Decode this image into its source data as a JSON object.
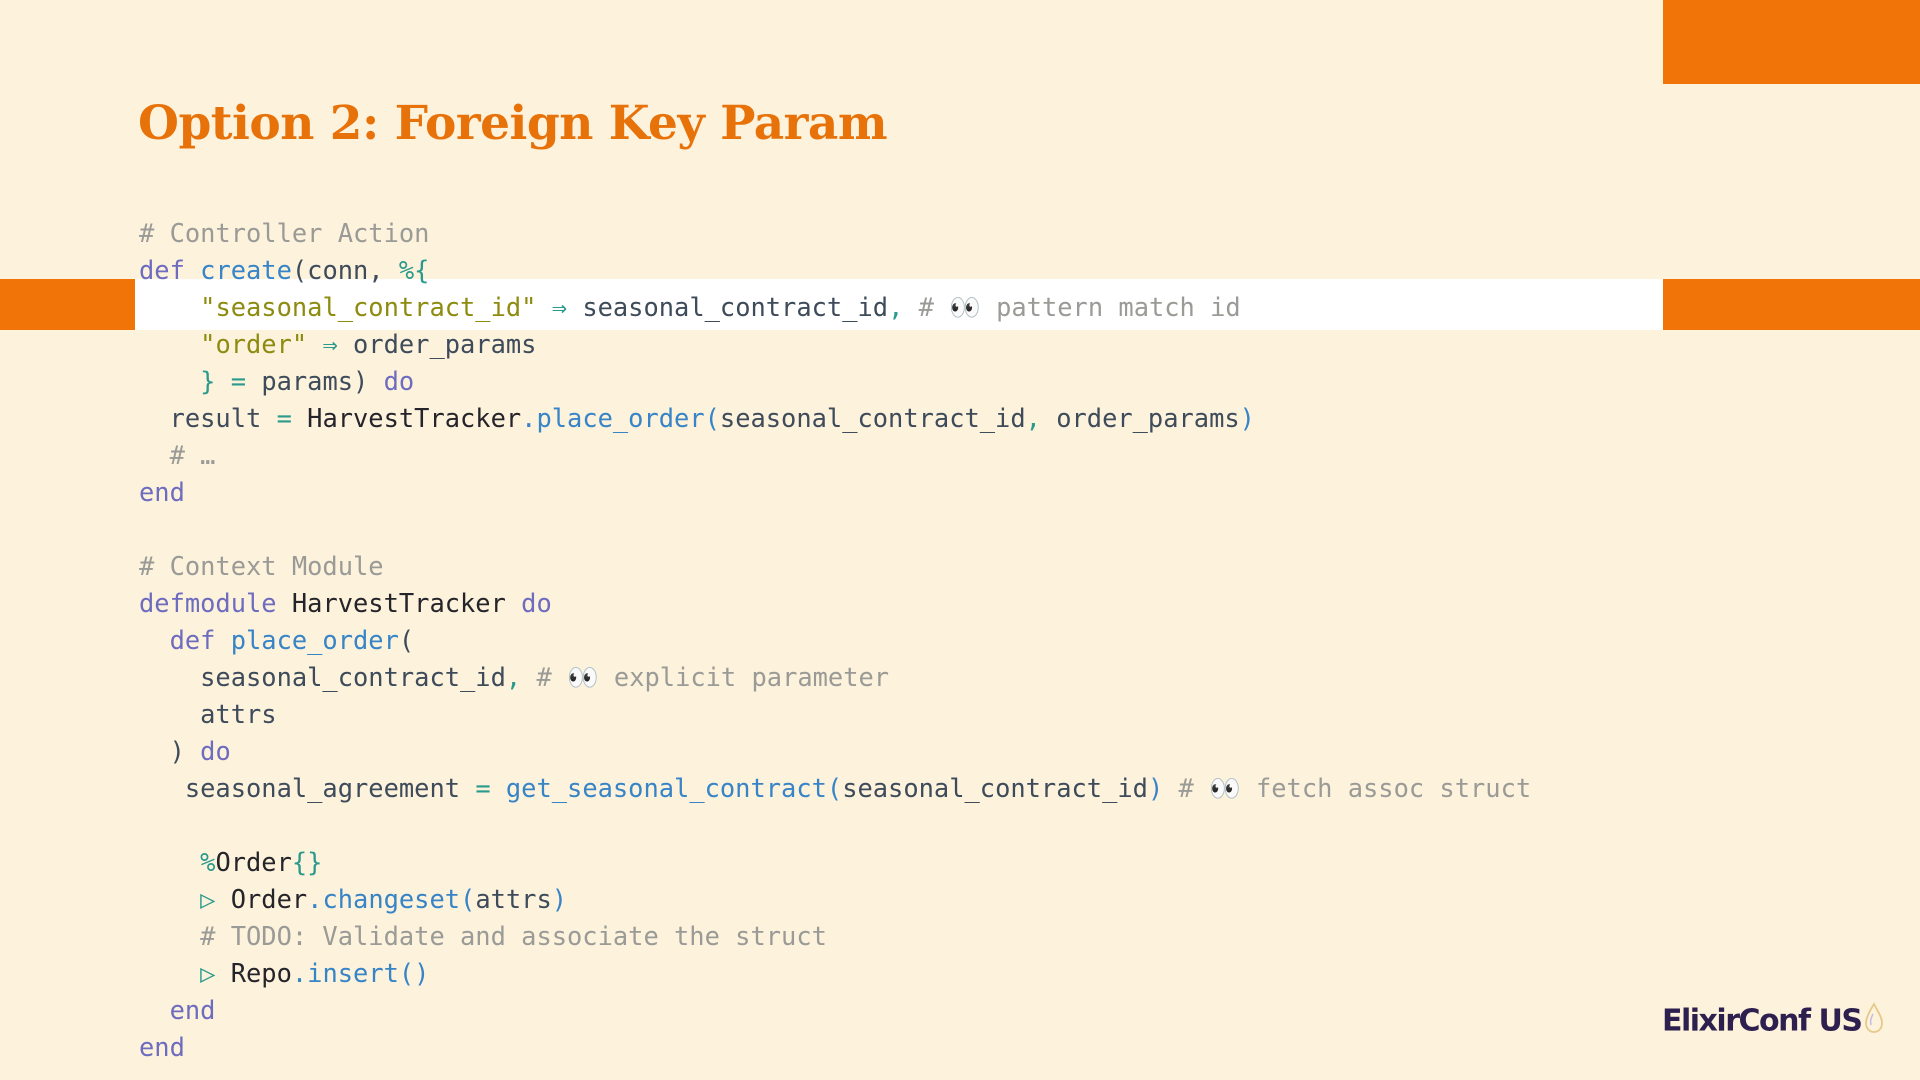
{
  "slide": {
    "title": "Option 2: Foreign Key Param",
    "logo_text": "ElixirConf US",
    "accent_color": "#f07407",
    "title_color": "#e8720a",
    "background": "#fdf2dc"
  },
  "code": {
    "lines": [
      [
        {
          "t": "# Controller Action",
          "c": "comment"
        }
      ],
      [
        {
          "t": "def ",
          "c": "kw"
        },
        {
          "t": "create",
          "c": "fn"
        },
        {
          "t": "(conn, ",
          "c": "var"
        },
        {
          "t": "%{",
          "c": "op"
        }
      ],
      [
        {
          "t": "    ",
          "c": "var"
        },
        {
          "t": "\"seasonal_contract_id\"",
          "c": "str"
        },
        {
          "t": " ⇒ ",
          "c": "op"
        },
        {
          "t": "seasonal_contract_id",
          "c": "var"
        },
        {
          "t": ", ",
          "c": "op"
        },
        {
          "t": "# 👀 pattern match id",
          "c": "comment"
        }
      ],
      [
        {
          "t": "    ",
          "c": "var"
        },
        {
          "t": "\"order\"",
          "c": "str"
        },
        {
          "t": " ⇒ ",
          "c": "op"
        },
        {
          "t": "order_params",
          "c": "var"
        }
      ],
      [
        {
          "t": "    ",
          "c": "var"
        },
        {
          "t": "}",
          "c": "op"
        },
        {
          "t": " = ",
          "c": "op"
        },
        {
          "t": "params) ",
          "c": "var"
        },
        {
          "t": "do",
          "c": "kw"
        }
      ],
      [
        {
          "t": "  result ",
          "c": "var"
        },
        {
          "t": "= ",
          "c": "op"
        },
        {
          "t": "HarvestTracker",
          "c": "mod"
        },
        {
          "t": ".place_order(",
          "c": "fn"
        },
        {
          "t": "seasonal_contract_id",
          "c": "var"
        },
        {
          "t": ", ",
          "c": "op"
        },
        {
          "t": "order_params",
          "c": "var"
        },
        {
          "t": ")",
          "c": "fn"
        }
      ],
      [
        {
          "t": "  # …",
          "c": "comment"
        }
      ],
      [
        {
          "t": "end",
          "c": "kw"
        }
      ],
      [
        {
          "t": "",
          "c": "var"
        }
      ],
      [
        {
          "t": "# Context Module",
          "c": "comment"
        }
      ],
      [
        {
          "t": "defmodule ",
          "c": "kw"
        },
        {
          "t": "HarvestTracker ",
          "c": "mod"
        },
        {
          "t": "do",
          "c": "kw"
        }
      ],
      [
        {
          "t": "  def ",
          "c": "kw"
        },
        {
          "t": "place_order",
          "c": "fn"
        },
        {
          "t": "(",
          "c": "var"
        }
      ],
      [
        {
          "t": "    seasonal_contract_id",
          "c": "var"
        },
        {
          "t": ", ",
          "c": "op"
        },
        {
          "t": "# 👀 explicit parameter",
          "c": "comment"
        }
      ],
      [
        {
          "t": "    attrs",
          "c": "var"
        }
      ],
      [
        {
          "t": "  ) ",
          "c": "var"
        },
        {
          "t": "do",
          "c": "kw"
        }
      ],
      [
        {
          "t": "   seasonal_agreement ",
          "c": "var"
        },
        {
          "t": "= ",
          "c": "op"
        },
        {
          "t": "get_seasonal_contract(",
          "c": "fn"
        },
        {
          "t": "seasonal_contract_id",
          "c": "var"
        },
        {
          "t": ") ",
          "c": "fn"
        },
        {
          "t": "# 👀 fetch assoc struct",
          "c": "comment"
        }
      ],
      [
        {
          "t": "",
          "c": "var"
        }
      ],
      [
        {
          "t": "    ",
          "c": "var"
        },
        {
          "t": "%",
          "c": "op"
        },
        {
          "t": "Order",
          "c": "mod"
        },
        {
          "t": "{}",
          "c": "op"
        }
      ],
      [
        {
          "t": "    ",
          "c": "var"
        },
        {
          "t": "▷ ",
          "c": "op"
        },
        {
          "t": "Order",
          "c": "mod"
        },
        {
          "t": ".changeset(",
          "c": "fn"
        },
        {
          "t": "attrs",
          "c": "var"
        },
        {
          "t": ")",
          "c": "fn"
        }
      ],
      [
        {
          "t": "    # TODO: Validate and associate the struct",
          "c": "comment"
        }
      ],
      [
        {
          "t": "    ",
          "c": "var"
        },
        {
          "t": "▷ ",
          "c": "op"
        },
        {
          "t": "Repo",
          "c": "mod"
        },
        {
          "t": ".insert()",
          "c": "fn"
        }
      ],
      [
        {
          "t": "  end",
          "c": "kw"
        }
      ],
      [
        {
          "t": "end",
          "c": "kw"
        }
      ]
    ]
  }
}
